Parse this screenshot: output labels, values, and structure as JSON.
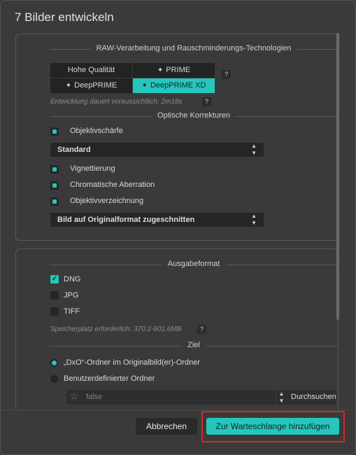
{
  "dialog": {
    "title": "7 Bilder entwickeln"
  },
  "raw": {
    "section_title": "RAW-Verarbeitung und Rauschminderungs-Technologien",
    "options": [
      {
        "label": "Hohe Qualität",
        "icon": ""
      },
      {
        "label": "PRIME",
        "icon": "✦"
      },
      {
        "label": "DeepPRIME",
        "icon": "✦"
      },
      {
        "label": "DeepPRIME XD",
        "icon": "✦"
      }
    ],
    "selected": "DeepPRIME XD",
    "help": "?",
    "duration_note": "Entwicklung dauert voraussichtlich:  2m18s"
  },
  "optical": {
    "section_title": "Optische Korrekturen",
    "sharpness": {
      "label": "Objektivschärfe",
      "state": "mixed"
    },
    "sharpness_select": "Standard",
    "vignetting": {
      "label": "Vignettierung",
      "state": "mixed"
    },
    "chromatic": {
      "label": "Chromatische Aberration",
      "state": "mixed"
    },
    "distortion": {
      "label": "Objektivverzeichnung",
      "state": "mixed"
    },
    "crop_select": "Bild auf Originalformat zugeschnitten"
  },
  "output": {
    "section_title": "Ausgabeformat",
    "dng": {
      "label": "DNG",
      "checked": true,
      "mark": "✓"
    },
    "jpg": {
      "label": "JPG",
      "checked": false
    },
    "tiff": {
      "label": "TIFF",
      "checked": false
    },
    "storage_note": "Speicherplatz erforderlich: 370.2-601.6MB",
    "help": "?"
  },
  "target": {
    "section_title": "Ziel",
    "dxo_folder": "„DxO“-Ordner im Originalbild(er)-Ordner",
    "custom_folder": "Benutzerdefinierter Ordner",
    "path_value": "false",
    "browse_label": "Durchsuchen",
    "selected": "dxo_folder"
  },
  "footer": {
    "cancel_label": "Abbrechen",
    "submit_label": "Zur Warteschlange hinzufügen"
  },
  "colors": {
    "accent": "#26c6bd",
    "highlight": "#d02b2b",
    "background": "#3a3a3a"
  }
}
